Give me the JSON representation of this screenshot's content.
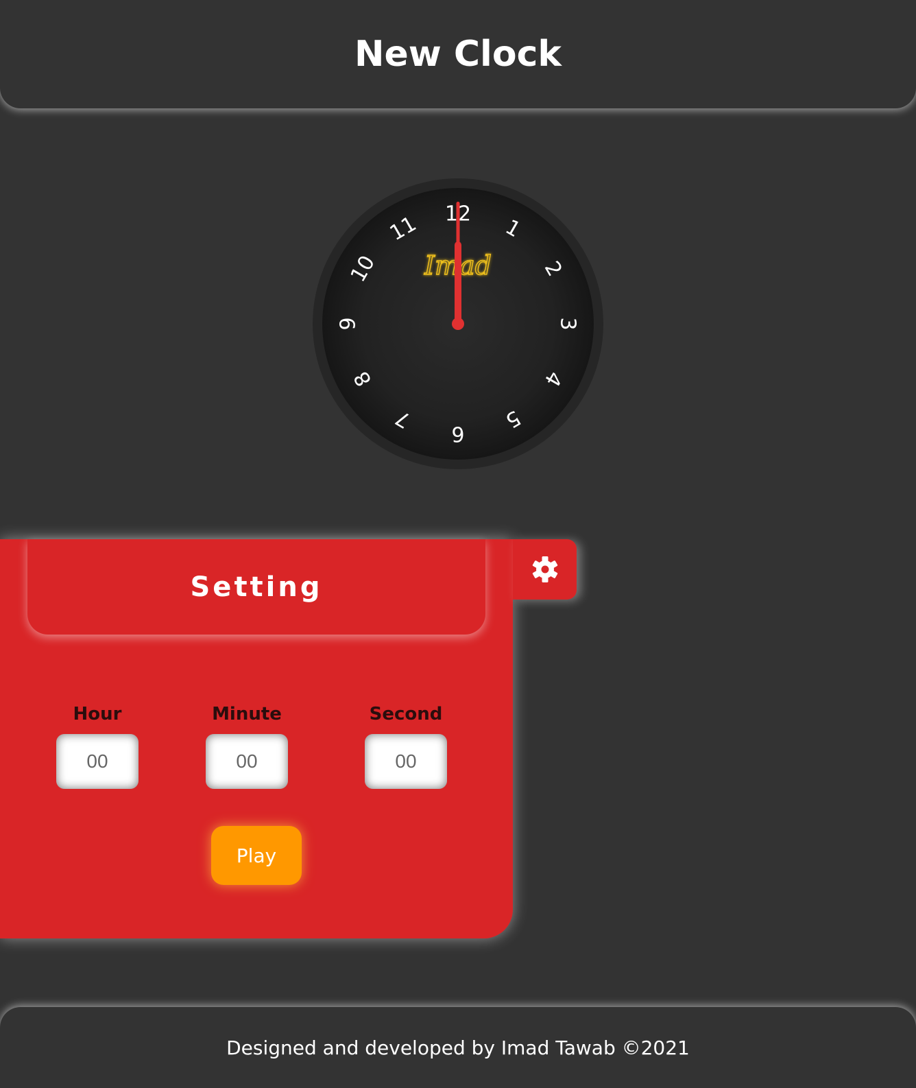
{
  "header": {
    "title": "New Clock"
  },
  "clock": {
    "brand": "Imad",
    "numbers": [
      "12",
      "1",
      "2",
      "3",
      "4",
      "5",
      "6",
      "7",
      "8",
      "9",
      "10",
      "11"
    ],
    "time": {
      "hour": 0,
      "minute": 0,
      "second": 0
    },
    "colors": {
      "face": "#1e1e1e",
      "rim": "#262626",
      "numbers": "#ffffff",
      "brand": "#f2c21b",
      "hand": "#e03131",
      "hand_highlight": "#ffffff"
    }
  },
  "settings": {
    "title": "Setting",
    "icon": "gear-icon",
    "fields": [
      {
        "label": "Hour",
        "placeholder": "00"
      },
      {
        "label": "Minute",
        "placeholder": "00"
      },
      {
        "label": "Second",
        "placeholder": "00"
      }
    ],
    "play_label": "Play",
    "colors": {
      "panel": "#d92527",
      "play": "#ff9800"
    }
  },
  "footer": {
    "text": "Designed and developed by Imad Tawab ©2021"
  }
}
